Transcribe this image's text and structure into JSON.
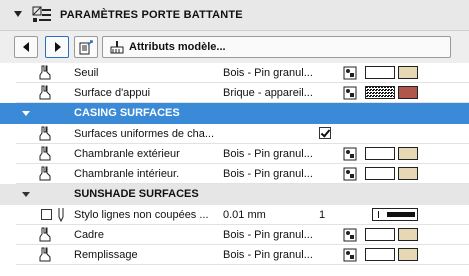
{
  "panel": {
    "title": "PARAMÈTRES PORTE BATTANTE"
  },
  "toolbar": {
    "attributes_label": "Attributs modèle..."
  },
  "rows_top": [
    {
      "label": "Seuil",
      "value": "Bois - Pin granul...",
      "swatch_color": "#e6d7b5"
    },
    {
      "label": "Surface d'appui",
      "value": "Brique - appareil...",
      "swatch_color": "#b0564a"
    }
  ],
  "casing": {
    "title": "CASING SURFACES",
    "uniform_label": "Surfaces uniformes de cha...",
    "uniform_checked": true,
    "rows": [
      {
        "label": "Chambranle extérieur",
        "value": "Bois - Pin granul...",
        "swatch_color": "#e6d7b5"
      },
      {
        "label": "Chambranle intérieur.",
        "value": "Bois - Pin granul...",
        "swatch_color": "#e6d7b5"
      }
    ]
  },
  "sunshade": {
    "title": "SUNSHADE SURFACES",
    "pen_row": {
      "label": "Stylo lignes non coupées ...",
      "value": "0.01 mm",
      "number": "1"
    },
    "rows": [
      {
        "label": "Cadre",
        "value": "Bois - Pin granul...",
        "swatch_color": "#e6d7b5"
      },
      {
        "label": "Remplissage",
        "value": "Bois - Pin granul...",
        "swatch_color": "#e6d7b5"
      }
    ]
  }
}
